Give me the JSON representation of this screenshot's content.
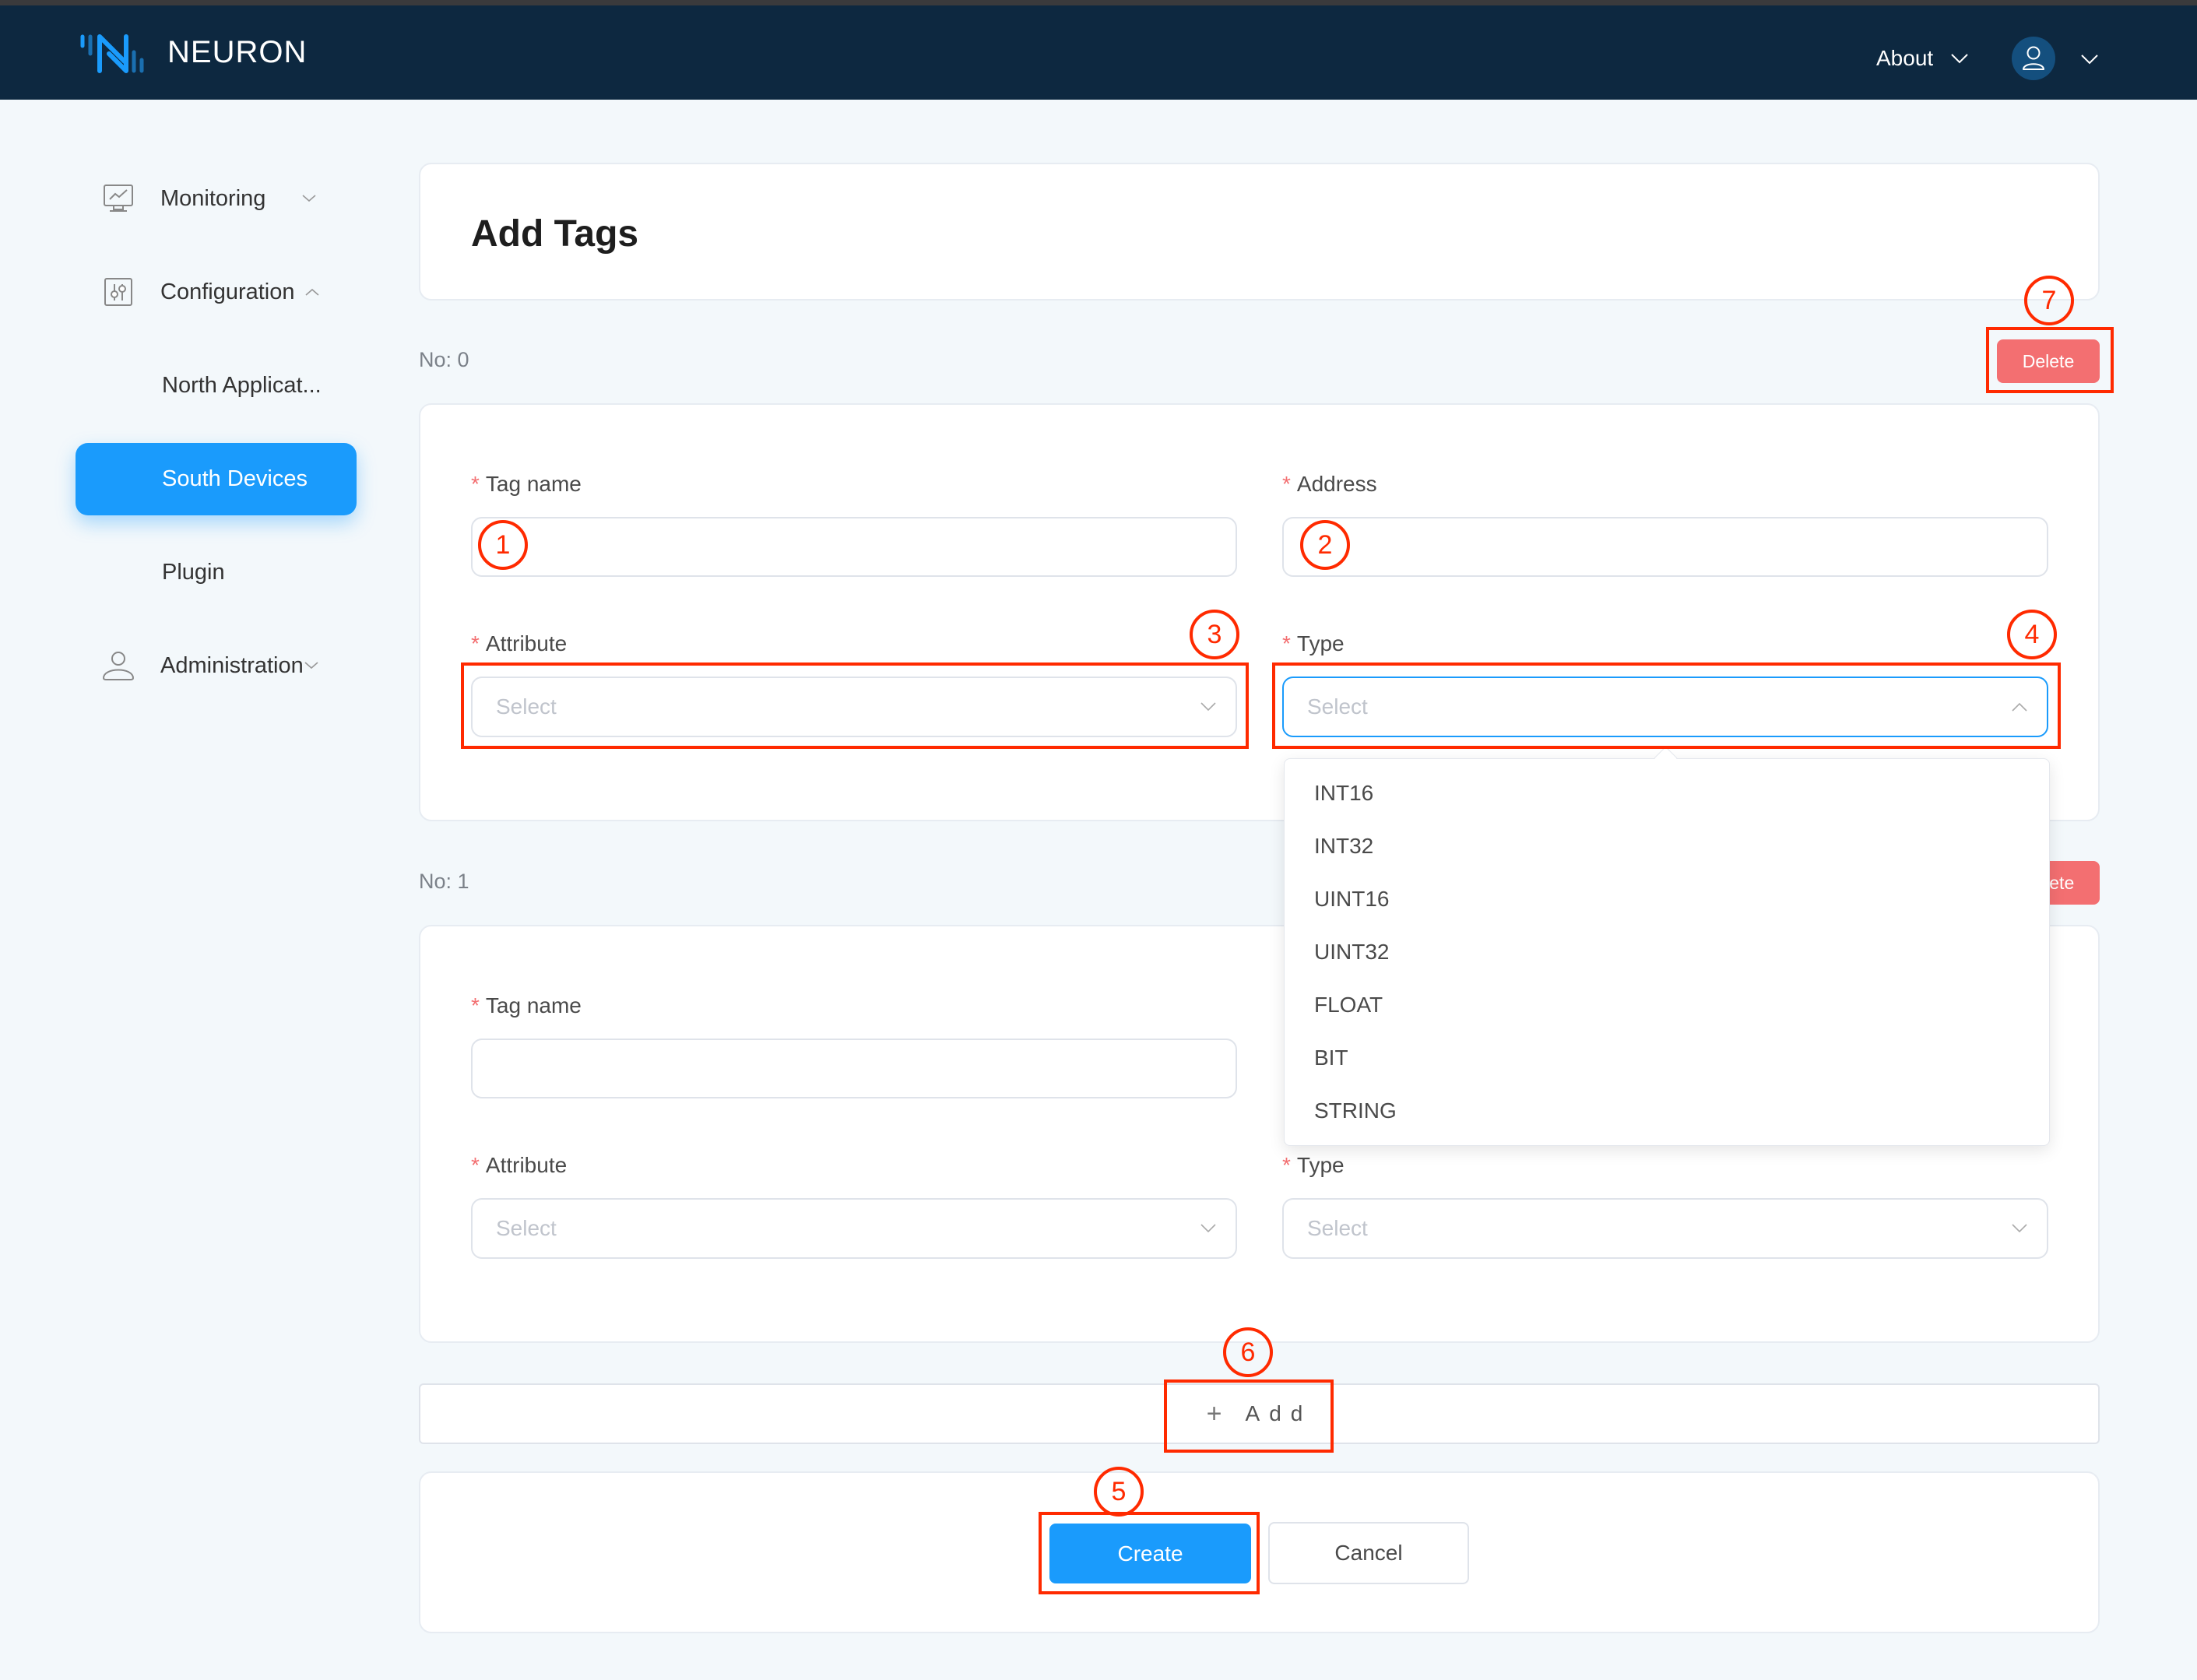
{
  "header": {
    "brand": "NEURON",
    "about_label": "About",
    "colors": {
      "background": "#0d2840",
      "avatar": "#144f7e",
      "logo": "#1a9bfc"
    }
  },
  "sidebar": {
    "items": [
      {
        "label": "Monitoring",
        "icon": "monitor-chart-icon",
        "expanded": false
      },
      {
        "label": "Configuration",
        "icon": "sliders-icon",
        "expanded": true
      },
      {
        "label": "Administration",
        "icon": "user-icon",
        "expanded": false
      }
    ],
    "sub_items": [
      {
        "label": "North Applicat...",
        "active": false
      },
      {
        "label": "South Devices",
        "active": true
      },
      {
        "label": "Plugin",
        "active": false
      }
    ],
    "active_color": "#1a9bfc"
  },
  "page": {
    "title": "Add Tags"
  },
  "tags": [
    {
      "no_label": "No: 0",
      "delete_label": "Delete",
      "tag_name_label": "Tag name",
      "tag_name_value": "",
      "address_label": "Address",
      "address_value": "",
      "attribute_label": "Attribute",
      "attribute_placeholder": "Select",
      "type_label": "Type",
      "type_placeholder": "Select",
      "type_open": true
    },
    {
      "no_label": "No: 1",
      "delete_label": "Delete",
      "tag_name_label": "Tag name",
      "tag_name_value": "",
      "attribute_label": "Attribute",
      "attribute_placeholder": "Select",
      "type_label": "Type",
      "type_placeholder": "Select",
      "type_open": false
    }
  ],
  "type_options": [
    "INT16",
    "INT32",
    "UINT16",
    "UINT32",
    "FLOAT",
    "BIT",
    "STRING"
  ],
  "required_mark": "*",
  "add_label": "Add",
  "add_icon": "+",
  "buttons": {
    "create_label": "Create",
    "cancel_label": "Cancel",
    "delete_color": "#f36f71"
  },
  "annotations": [
    "1",
    "2",
    "3",
    "4",
    "5",
    "6",
    "7"
  ],
  "annotation_color": "#ff2a00"
}
